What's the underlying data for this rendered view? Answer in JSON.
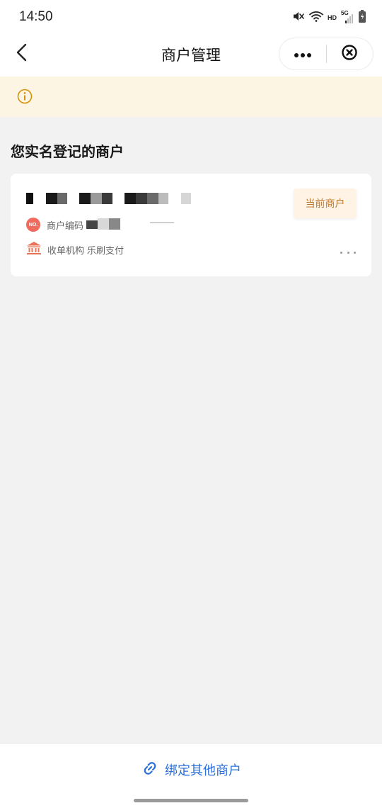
{
  "status_bar": {
    "time": "14:50",
    "icons": [
      "mute-icon",
      "wifi-icon",
      "hd-icon",
      "signal-5g-icon",
      "battery-icon"
    ],
    "hd_label": "HD",
    "network_label": "5G"
  },
  "nav": {
    "title": "商户管理",
    "back_icon": "chevron-left-icon",
    "more_icon": "more-icon",
    "close_icon": "close-circle-icon"
  },
  "notice": {
    "icon": "info-icon",
    "text": ""
  },
  "section": {
    "title": "您实名登记的商户"
  },
  "merchant_card": {
    "badge": "当前商户",
    "merchant_code_label": "商户编码",
    "merchant_code_icon_text": "NO.",
    "acquirer_label": "收单机构",
    "acquirer_value": "乐刷支付",
    "acquirer_icon": "bank-icon",
    "more_icon": "more-dots-icon"
  },
  "bottom": {
    "bind_label": "绑定其他商户",
    "bind_icon": "link-icon"
  },
  "colors": {
    "accent_blue": "#2a6fd8",
    "badge_text": "#c07a2e",
    "badge_bg": "#fff3e6",
    "notice_bg": "#fdf5e4",
    "notice_icon": "#d4900a",
    "no_icon_bg": "#f06b5e",
    "bank_icon": "#e8745a"
  }
}
